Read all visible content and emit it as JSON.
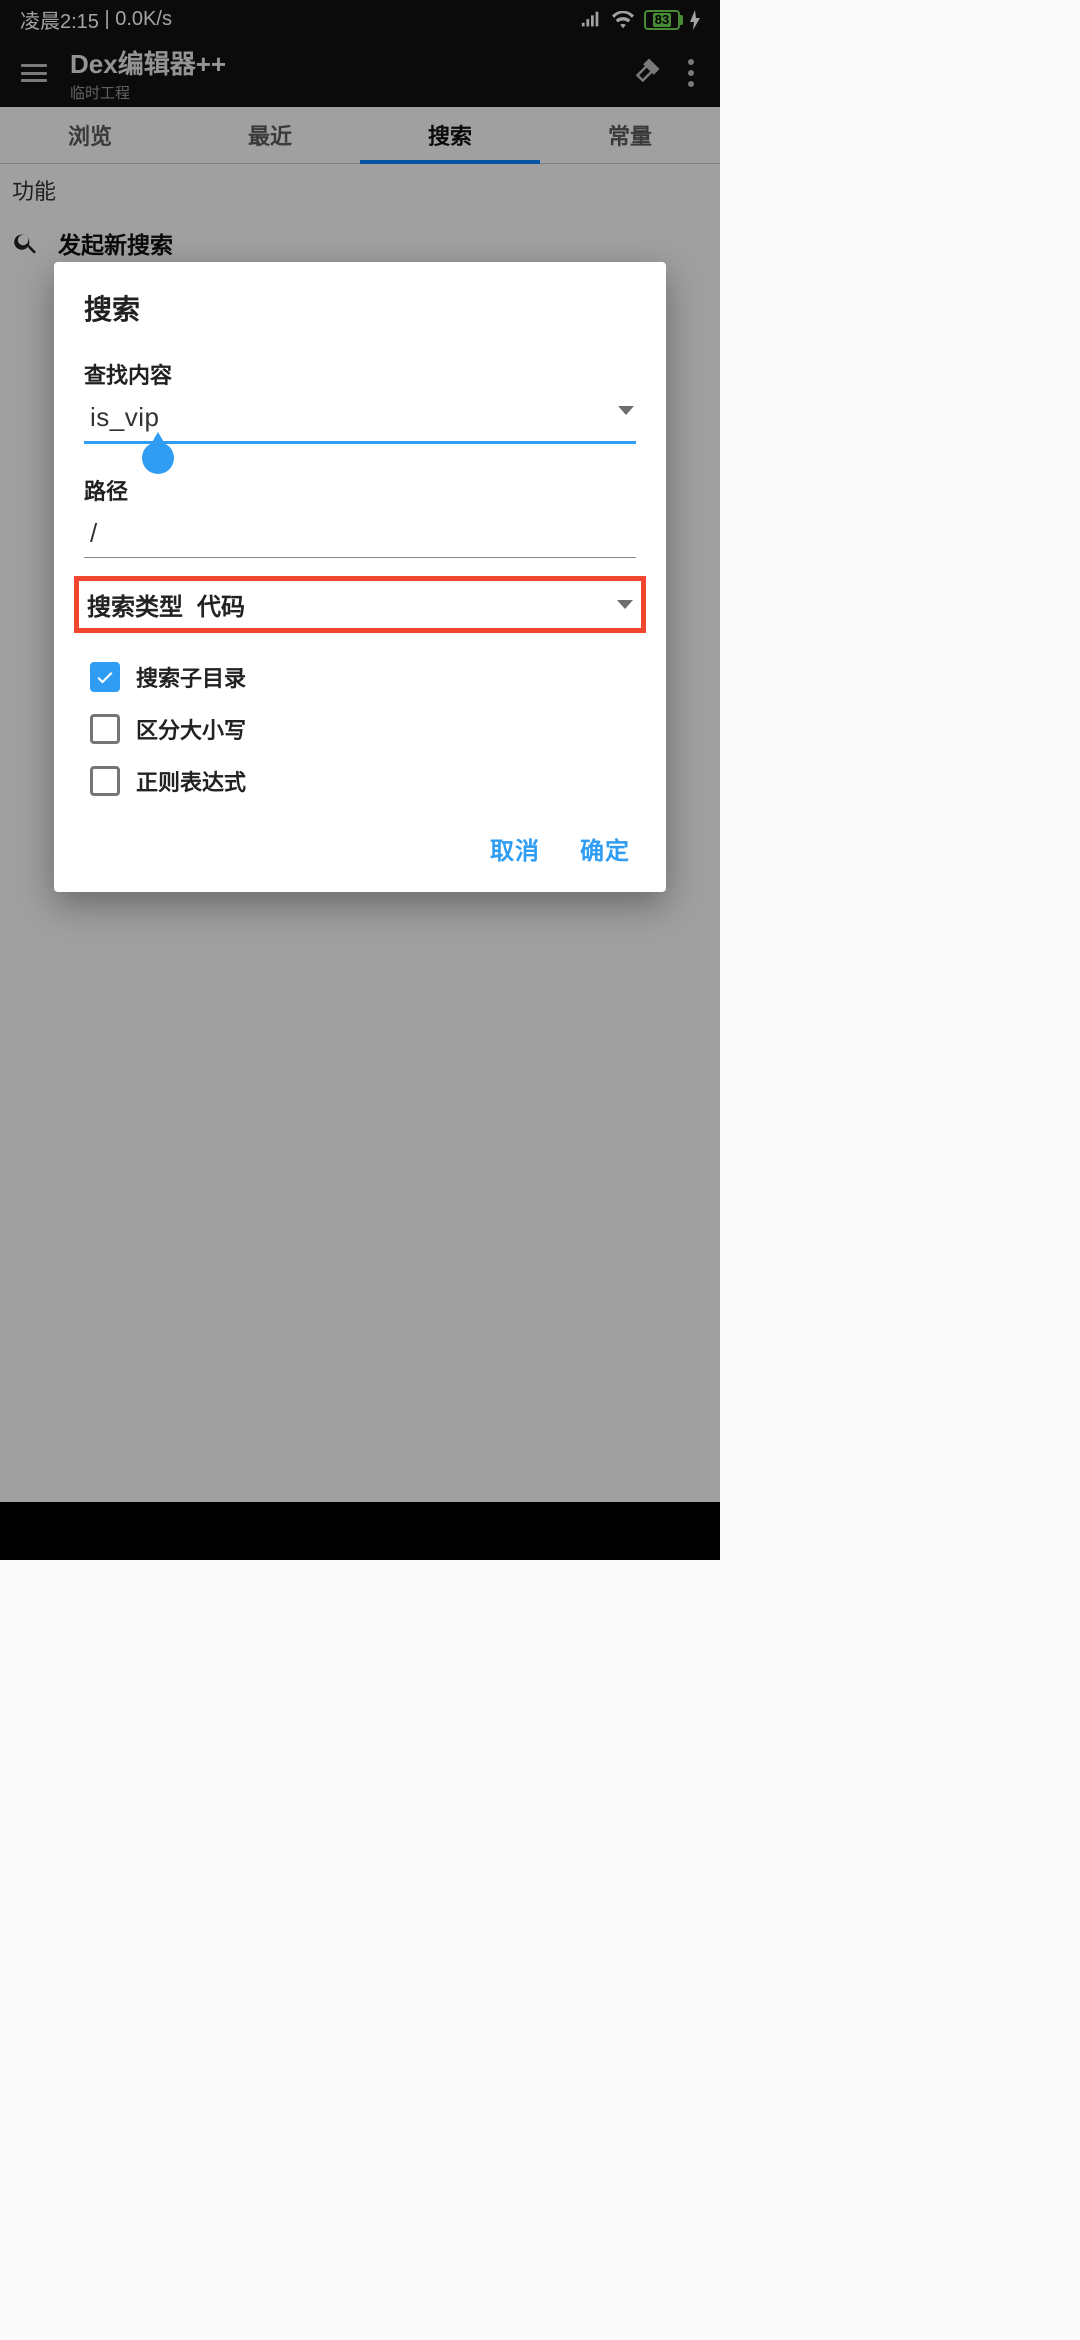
{
  "status": {
    "time_label": "凌晨2:15",
    "speed": "0.0K/s",
    "battery": "83"
  },
  "appbar": {
    "title": "Dex编辑器++",
    "subtitle": "临时工程"
  },
  "tabs": {
    "items": [
      "浏览",
      "最近",
      "搜索",
      "常量"
    ],
    "active_index": 2
  },
  "section": {
    "header": "功能",
    "new_search": "发起新搜索"
  },
  "dialog": {
    "title": "搜索",
    "find_label": "查找内容",
    "find_value": "is_vip",
    "path_label": "路径",
    "path_value": "/",
    "type_label": "搜索类型",
    "type_value": "代码",
    "options": [
      {
        "label": "搜索子目录",
        "checked": true
      },
      {
        "label": "区分大小写",
        "checked": false
      },
      {
        "label": "正则表达式",
        "checked": false
      }
    ],
    "cancel": "取消",
    "ok": "确定"
  }
}
